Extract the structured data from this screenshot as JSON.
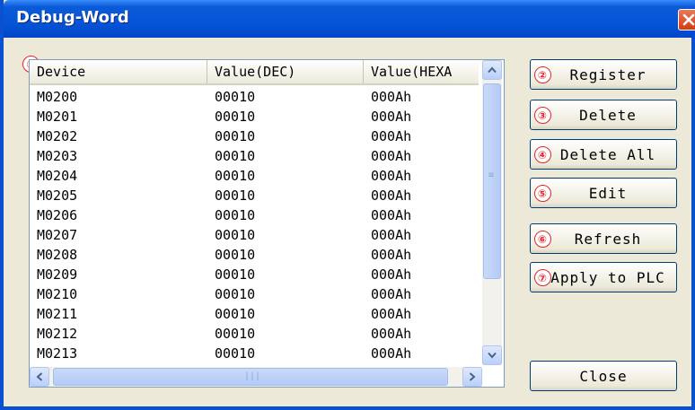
{
  "window": {
    "title": "Debug-Word"
  },
  "list": {
    "marker": "①",
    "columns": [
      "Device",
      "Value(DEC)",
      "Value(HEXA"
    ],
    "rows": [
      [
        "M0200",
        "00010",
        "000Ah"
      ],
      [
        "M0201",
        "00010",
        "000Ah"
      ],
      [
        "M0202",
        "00010",
        "000Ah"
      ],
      [
        "M0203",
        "00010",
        "000Ah"
      ],
      [
        "M0204",
        "00010",
        "000Ah"
      ],
      [
        "M0205",
        "00010",
        "000Ah"
      ],
      [
        "M0206",
        "00010",
        "000Ah"
      ],
      [
        "M0207",
        "00010",
        "000Ah"
      ],
      [
        "M0208",
        "00010",
        "000Ah"
      ],
      [
        "M0209",
        "00010",
        "000Ah"
      ],
      [
        "M0210",
        "00010",
        "000Ah"
      ],
      [
        "M0211",
        "00010",
        "000Ah"
      ],
      [
        "M0212",
        "00010",
        "000Ah"
      ],
      [
        "M0213",
        "00010",
        "000Ah"
      ]
    ]
  },
  "buttons": {
    "register": {
      "marker": "②",
      "label": "Register"
    },
    "delete": {
      "marker": "③",
      "label": "Delete"
    },
    "delete_all": {
      "marker": "④",
      "label": "Delete All"
    },
    "edit": {
      "marker": "⑤",
      "label": "Edit"
    },
    "refresh": {
      "marker": "⑥",
      "label": "Refresh"
    },
    "apply": {
      "marker": "⑦",
      "label": "Apply to PLC"
    },
    "close": {
      "label": "Close"
    }
  },
  "icons": {
    "close": "close-icon",
    "scroll_up": "scroll-up-icon",
    "scroll_down": "scroll-down-icon",
    "scroll_left": "scroll-left-icon",
    "scroll_right": "scroll-right-icon"
  },
  "colors": {
    "titlebar": "#0654d8",
    "face": "#ece9d8",
    "marker": "#e4242c"
  }
}
